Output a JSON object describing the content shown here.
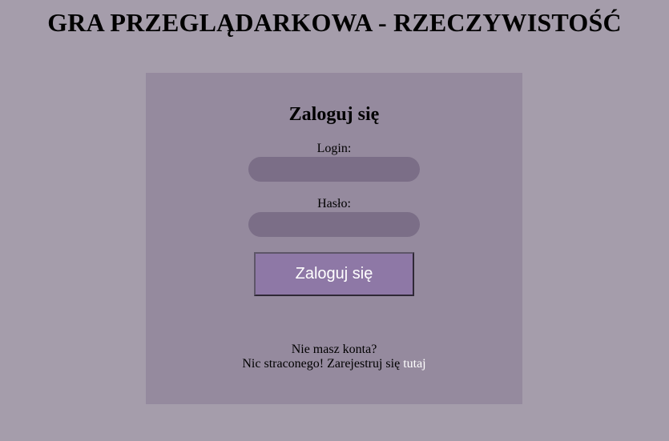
{
  "header": {
    "title": "GRA PRZEGLĄDARKOWA - RZECZYWISTOŚĆ"
  },
  "login_form": {
    "title": "Zaloguj się",
    "login_label": "Login:",
    "login_value": "",
    "password_label": "Hasło:",
    "password_value": "",
    "submit_label": "Zaloguj się"
  },
  "register": {
    "question": "Nie masz konta?",
    "prompt": "Nic straconego! Zarejestruj się",
    "link_text": "tutaj"
  },
  "colors": {
    "background": "#a59dab",
    "panel": "#958a9e",
    "input": "#7b6e87",
    "button": "#8e78a6",
    "link": "#ffffff"
  }
}
